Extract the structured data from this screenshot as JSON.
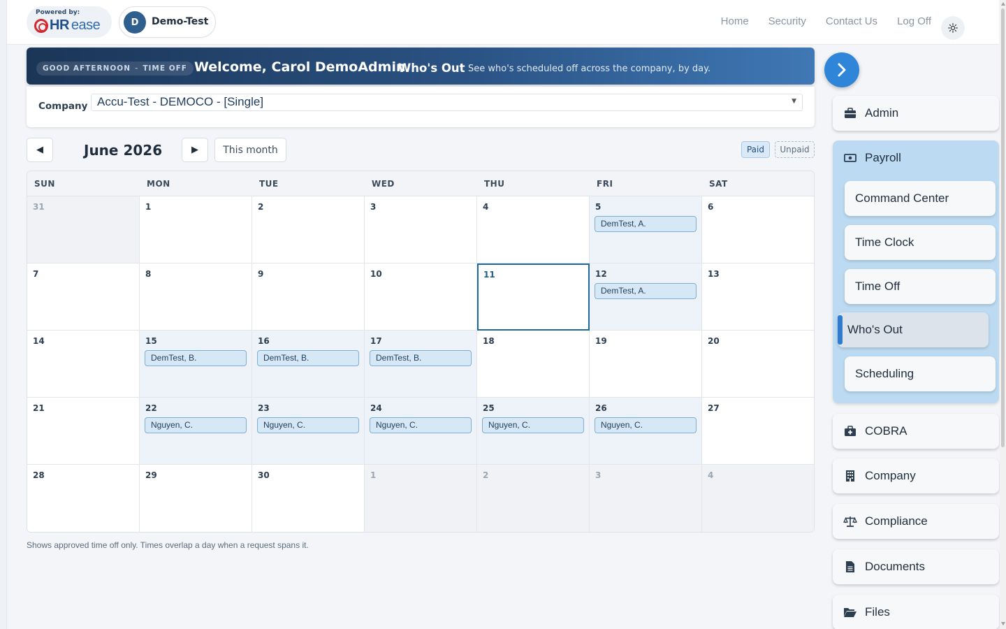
{
  "header": {
    "powered_by": "Powered by:",
    "logo_hr": "HR",
    "logo_ease": "ease",
    "tenant_initial": "D",
    "tenant_name": "Demo-Test",
    "nav": [
      "Home",
      "Security",
      "Contact Us",
      "Log Off"
    ]
  },
  "banner": {
    "greeting": "GOOD AFTERNOON",
    "section": "TIME OFF",
    "welcome": "Welcome, Carol DemoAdmin",
    "page_title": "Who's Out",
    "description": "See who's scheduled off across the company, by day."
  },
  "company": {
    "label": "Company",
    "selected": "Accu-Test - DEMOCO - [Single]"
  },
  "calendar": {
    "month_title": "June 2026",
    "prev_symbol": "◀",
    "next_symbol": "▶",
    "this_month": "This month",
    "legend_paid": "Paid",
    "legend_unpaid": "Unpaid",
    "weekdays": [
      "SUN",
      "MON",
      "TUE",
      "WED",
      "THU",
      "FRI",
      "SAT"
    ],
    "today": "11",
    "weeks": [
      [
        {
          "d": "31",
          "out": true
        },
        {
          "d": "1"
        },
        {
          "d": "2"
        },
        {
          "d": "3"
        },
        {
          "d": "4"
        },
        {
          "d": "5",
          "ev": "DemTest, A."
        },
        {
          "d": "6"
        }
      ],
      [
        {
          "d": "7"
        },
        {
          "d": "8"
        },
        {
          "d": "9"
        },
        {
          "d": "10"
        },
        {
          "d": "11",
          "today": true
        },
        {
          "d": "12",
          "ev": "DemTest, A."
        },
        {
          "d": "13"
        }
      ],
      [
        {
          "d": "14"
        },
        {
          "d": "15",
          "ev": "DemTest, B."
        },
        {
          "d": "16",
          "ev": "DemTest, B."
        },
        {
          "d": "17",
          "ev": "DemTest, B."
        },
        {
          "d": "18"
        },
        {
          "d": "19"
        },
        {
          "d": "20"
        }
      ],
      [
        {
          "d": "21"
        },
        {
          "d": "22",
          "ev": "Nguyen, C."
        },
        {
          "d": "23",
          "ev": "Nguyen, C."
        },
        {
          "d": "24",
          "ev": "Nguyen, C."
        },
        {
          "d": "25",
          "ev": "Nguyen, C."
        },
        {
          "d": "26",
          "ev": "Nguyen, C."
        },
        {
          "d": "27"
        }
      ],
      [
        {
          "d": "28"
        },
        {
          "d": "29"
        },
        {
          "d": "30"
        },
        {
          "d": "1",
          "out": true
        },
        {
          "d": "2",
          "out": true
        },
        {
          "d": "3",
          "out": true
        },
        {
          "d": "4",
          "out": true
        }
      ]
    ],
    "footnote": "Shows approved time off only. Times overlap a day when a request spans it."
  },
  "sidebar": {
    "admin": "Admin",
    "payroll": "Payroll",
    "payroll_items": [
      "Command Center",
      "Time Clock",
      "Time Off",
      "Who's Out",
      "Scheduling"
    ],
    "active_item": "Who's Out",
    "cobra": "COBRA",
    "company": "Company",
    "compliance": "Compliance",
    "documents": "Documents",
    "files": "Files"
  },
  "colors": {
    "accent": "#2f86d8",
    "banner_start": "#1b3556",
    "banner_end": "#3f78b5",
    "event_bg": "#d6e7f5",
    "event_border": "#7eaed6",
    "today_border": "#1f6a9a",
    "payroll_group": "#bcdaf1"
  }
}
